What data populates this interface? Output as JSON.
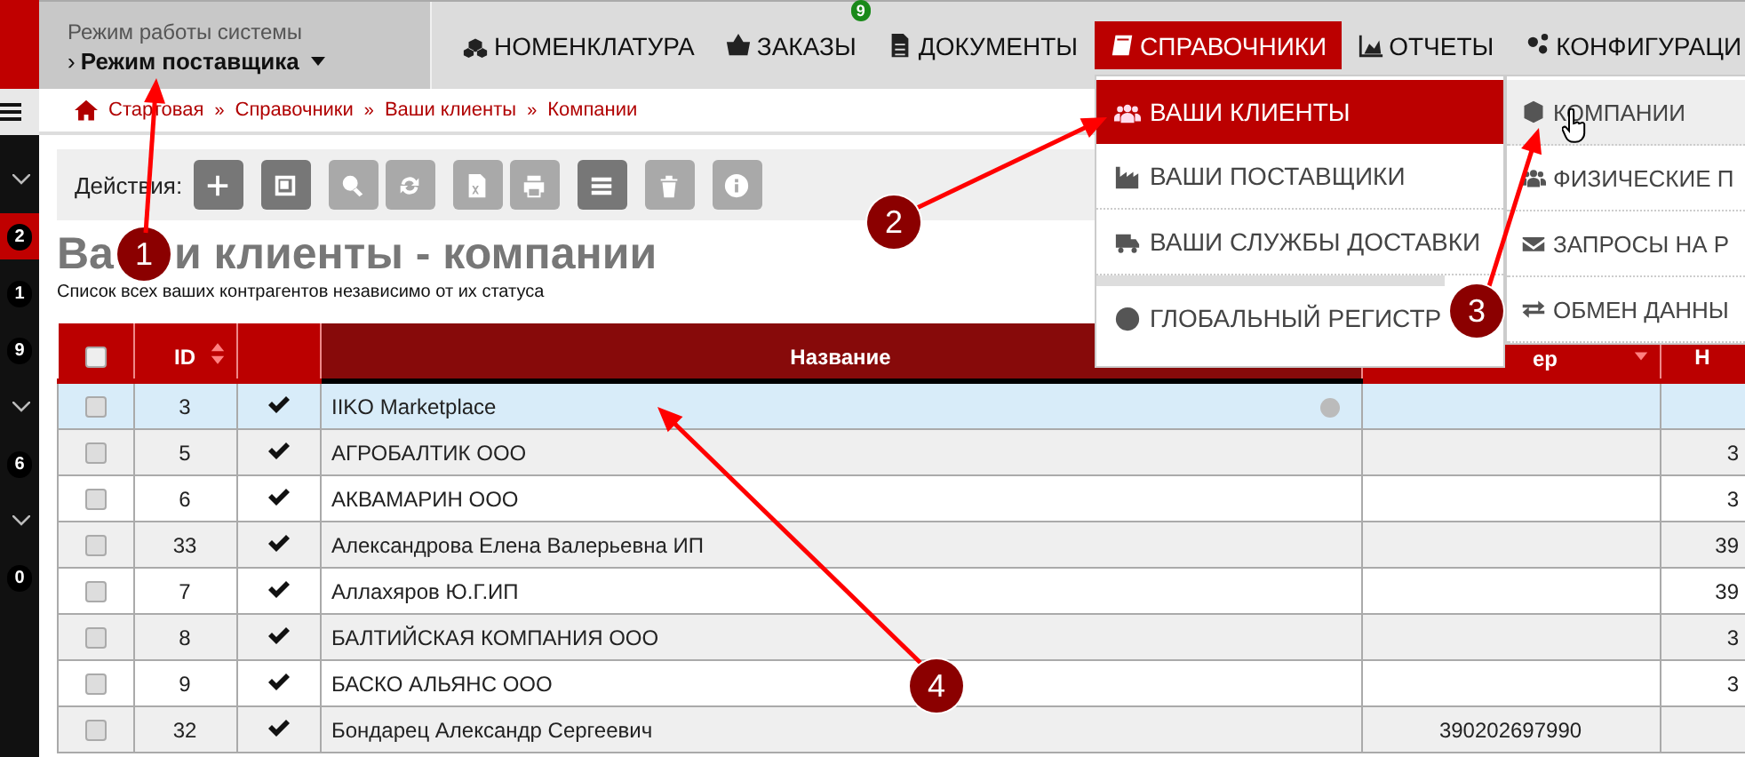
{
  "sidebar": {
    "items": [
      {
        "kind": "chevron",
        "selected": false
      },
      {
        "kind": "badge",
        "text": "2",
        "selected": true
      },
      {
        "kind": "badge",
        "text": "1",
        "selected": false
      },
      {
        "kind": "badge",
        "text": "9",
        "selected": false
      },
      {
        "kind": "chevron",
        "selected": false
      },
      {
        "kind": "badge",
        "text": "6",
        "selected": false
      },
      {
        "kind": "chevron",
        "selected": false
      },
      {
        "kind": "badge",
        "text": "0",
        "selected": false
      }
    ]
  },
  "mode": {
    "label": "Режим работы системы",
    "prefix": "›",
    "value": "Режим поставщика"
  },
  "nav": [
    {
      "label": "НОМЕНКЛАТУРА",
      "selected": false
    },
    {
      "label": "ЗАКАЗЫ",
      "selected": false,
      "badge": "9"
    },
    {
      "label": "ДОКУМЕНТЫ",
      "selected": false
    },
    {
      "label": "СПРАВОЧНИКИ",
      "selected": true
    },
    {
      "label": "ОТЧЕТЫ",
      "selected": false
    },
    {
      "label": "КОНФИГУРАЦИ",
      "selected": false
    }
  ],
  "breadcrumb": [
    {
      "label": "Стартовая"
    },
    {
      "separator": "»",
      "label": "Справочники"
    },
    {
      "separator": "»",
      "label": "Ваши клиенты"
    },
    {
      "separator": "»",
      "label": "Компании"
    }
  ],
  "toolbar": {
    "label": "Действия:",
    "buttons": [
      {
        "disabled": false
      },
      {
        "disabled": false
      },
      {
        "disabled": true
      },
      {
        "disabled": true
      },
      {
        "disabled": true
      },
      {
        "disabled": true
      },
      {
        "disabled": false
      },
      {
        "disabled": true
      },
      {
        "disabled": true
      }
    ]
  },
  "page": {
    "title_parts": [
      "Ва",
      "и клиенты - компании"
    ],
    "subtitle": "Список всех ваших контрагентов независимо от их статуса"
  },
  "table": {
    "columns": [
      {
        "checked": false
      },
      {
        "label": "ID",
        "sort_up": true,
        "sort_down": true
      },
      {},
      {
        "label": "Название"
      },
      {
        "label": "ер",
        "sort_up": false,
        "sort_down": true
      },
      {
        "label": "Н"
      }
    ],
    "rows": [
      {
        "checked": false,
        "id": "3",
        "confirmed": true,
        "name": "IIKO Marketplace",
        "global": true,
        "selected": true
      },
      {
        "checked": false,
        "id": "5",
        "confirmed": true,
        "name": "АГРОБАЛТИК ООО",
        "global": false,
        "column_6": "3",
        "selected": false
      },
      {
        "checked": false,
        "id": "6",
        "confirmed": true,
        "name": "АКВАМАРИН ООО",
        "global": false,
        "column_6": "3",
        "selected": false
      },
      {
        "checked": false,
        "id": "33",
        "confirmed": true,
        "name": "Александрова Елена Валерьевна ИП",
        "global": false,
        "column_6": "39",
        "selected": false
      },
      {
        "checked": false,
        "id": "7",
        "confirmed": true,
        "name": "Аллахяров Ю.Г.ИП",
        "global": false,
        "column_6": "39",
        "selected": false
      },
      {
        "checked": false,
        "id": "8",
        "confirmed": true,
        "name": "БАЛТИЙСКАЯ КОМПАНИЯ ООО",
        "global": false,
        "column_6": "3",
        "selected": false
      },
      {
        "checked": false,
        "id": "9",
        "confirmed": true,
        "name": "БАСКО АЛЬЯНС ООО",
        "global": false,
        "column_6": "3",
        "selected": false
      },
      {
        "checked": false,
        "id": "32",
        "confirmed": true,
        "name": "Бондарец Александр Сергеевич",
        "global": false,
        "column_5": "390202697990",
        "selected": false
      }
    ]
  },
  "menu": {
    "items": [
      {
        "label": "ВАШИ КЛИЕНТЫ",
        "selected": true,
        "divider": false
      },
      {
        "label": "ВАШИ ПОСТАВЩИКИ",
        "selected": false,
        "divider": false
      },
      {
        "label": "ВАШИ СЛУЖБЫ ДОСТАВКИ",
        "selected": false,
        "divider": false
      },
      {
        "label": "ГЛОБАЛЬНЫЙ РЕГИСТР",
        "selected": false,
        "divider": true
      }
    ],
    "submenu": [
      {
        "label": "КОМПАНИИ",
        "selected": true
      },
      {
        "label": "ФИЗИЧЕСКИЕ П",
        "selected": false
      },
      {
        "label": "ЗАПРОСЫ НА Р",
        "selected": false
      },
      {
        "label": "ОБМЕН ДАННЫ",
        "selected": false
      }
    ]
  },
  "annotations": [
    {
      "number": "1"
    },
    {
      "number": "2"
    },
    {
      "number": "3"
    },
    {
      "number": "4"
    }
  ]
}
